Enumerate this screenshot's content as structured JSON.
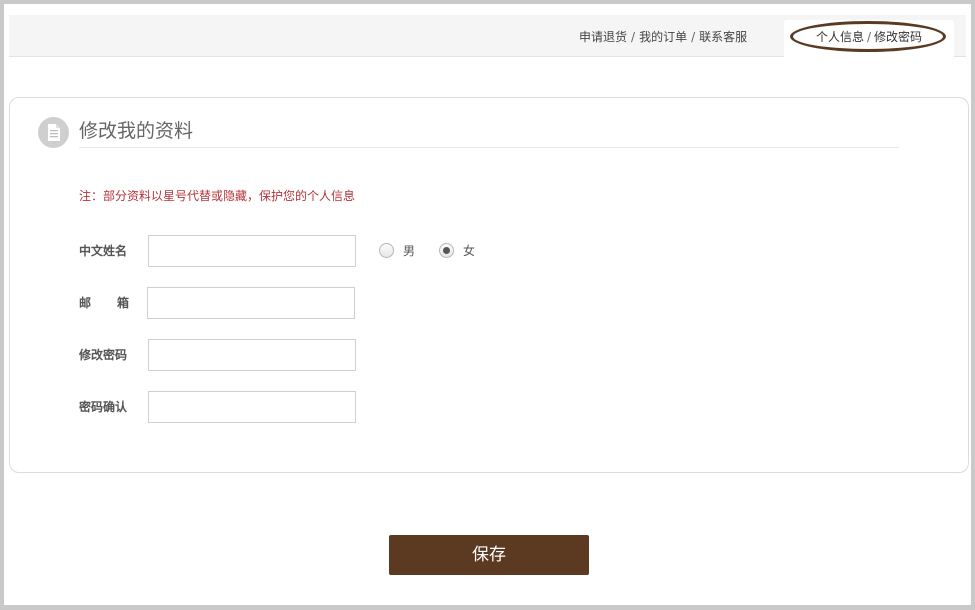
{
  "topnav": {
    "links": [
      "申请退货",
      "我的订单",
      "联系客服"
    ],
    "separator": "/"
  },
  "active_tab": {
    "items": [
      "个人信息",
      "修改密码"
    ],
    "separator": "/"
  },
  "form": {
    "title": "修改我的资料",
    "note": "注：部分资料以星号代替或隐藏，保护您的个人信息",
    "fields": {
      "name_label": "中文姓名",
      "email_label_a": "邮",
      "email_label_b": "箱",
      "password_label": "修改密码",
      "confirm_label": "密码确认"
    },
    "gender": {
      "male": "男",
      "female": "女",
      "selected": "女"
    },
    "values": {
      "name": "",
      "email": "",
      "password": "",
      "confirm": ""
    }
  },
  "save_label": "保存",
  "colors": {
    "accent": "#5c3921",
    "note": "#b4343a",
    "highlight_oval": "#5a3a22"
  }
}
